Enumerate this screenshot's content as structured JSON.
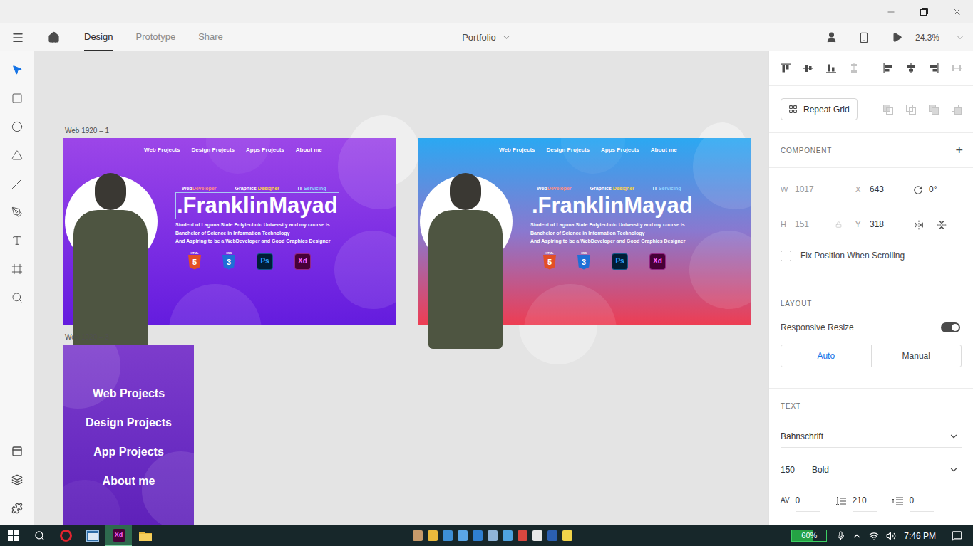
{
  "appbar": {
    "tabs": [
      {
        "label": "Design",
        "selected": true
      },
      {
        "label": "Prototype",
        "selected": false
      },
      {
        "label": "Share",
        "selected": false
      }
    ],
    "document": "Portfolio",
    "zoom": "24.3%"
  },
  "tools": [
    {
      "kind": "select",
      "selected": true
    },
    {
      "kind": "rectangle",
      "selected": false
    },
    {
      "kind": "ellipse",
      "selected": false
    },
    {
      "kind": "triangle",
      "selected": false
    },
    {
      "kind": "line",
      "selected": false
    },
    {
      "kind": "pen",
      "selected": false
    },
    {
      "kind": "text",
      "selected": false
    },
    {
      "kind": "artboard",
      "selected": false
    },
    {
      "kind": "zoom",
      "selected": false
    }
  ],
  "panels": [
    {
      "kind": "assets",
      "selected": false
    },
    {
      "kind": "layers",
      "selected": false
    },
    {
      "kind": "plugins",
      "selected": false
    }
  ],
  "canvas": {
    "artboards": [
      {
        "kind": "hero",
        "label": "Web 1920 – 1",
        "color": "#9c46e8",
        "color_mid": "#7f30e4",
        "color_to": "#641cde",
        "nav": [
          "Web Projects",
          "Design Projects",
          "Apps Projects",
          "About me"
        ],
        "tags": [
          [
            {
              "text": "Web",
              "color": "#ffffff"
            },
            {
              "text": "Developer",
              "color": "#ff8f7e"
            }
          ],
          [
            {
              "text": "Graphics ",
              "color": "#ffffff"
            },
            {
              "text": "Designer",
              "color": "#ffd54a"
            }
          ],
          [
            {
              "text": "IT ",
              "color": "#ffffff"
            },
            {
              "text": "Servicing",
              "color": "#8fd3ff"
            }
          ]
        ],
        "name": ".FranklinMayad",
        "name_selected": true,
        "bio": [
          "Student of Laguna State Polytechnic University and my course is",
          "Banchelor of Science in Information Technology",
          "And Aspiring to be a WebDeveloper and Good Graphics Designer"
        ],
        "skills": [
          {
            "kind": "html",
            "caption": "HTML",
            "mark": "5"
          },
          {
            "kind": "css",
            "caption": "CSS",
            "mark": "3"
          },
          {
            "kind": "ps",
            "mark": "Ps"
          },
          {
            "kind": "xd",
            "mark": "Xd"
          }
        ]
      },
      {
        "kind": "hero",
        "color": "#2ba8f2",
        "color_mid": "#8a78cf",
        "color_to": "#ee3d52",
        "nav": [
          "Web Projects",
          "Design Projects",
          "Apps Projects",
          "About me"
        ],
        "tags": [
          [
            {
              "text": "Web",
              "color": "#ffffff"
            },
            {
              "text": "Developer",
              "color": "#ff8f7e"
            }
          ],
          [
            {
              "text": "Graphics ",
              "color": "#ffffff"
            },
            {
              "text": "Designer",
              "color": "#ffd54a"
            }
          ],
          [
            {
              "text": "IT ",
              "color": "#ffffff"
            },
            {
              "text": "Servicing",
              "color": "#8fd3ff"
            }
          ]
        ],
        "name": ".FranklinMayad",
        "name_selected": false,
        "bio": [
          "Student of Laguna State Polytechnic University and my course is",
          "Banchelor of Science in Information Technology",
          "And Aspiring to be a WebDeveloper and Good Graphics Designer"
        ],
        "skills": [
          {
            "kind": "html",
            "caption": "HTML",
            "mark": "5"
          },
          {
            "kind": "css",
            "caption": "CSS",
            "mark": "3"
          },
          {
            "kind": "ps",
            "mark": "Ps"
          },
          {
            "kind": "xd",
            "mark": "Xd"
          }
        ]
      },
      {
        "kind": "menu",
        "label": "Web 1920 – 3",
        "color": "#7d3ccc",
        "color_mid": "#6a2cc2",
        "color_to": "#5a1cb6",
        "items": [
          "Web Projects",
          "Design Projects",
          "App Projects",
          "About me"
        ]
      }
    ]
  },
  "inspector": {
    "repeat_grid": "Repeat Grid",
    "component": {
      "title": "COMPONENT",
      "add": "+"
    },
    "transform": {
      "fields": [
        {
          "label": "W",
          "value": "1017",
          "disabled": true
        },
        {
          "label": "X",
          "value": "643",
          "disabled": false
        },
        {
          "label": "H",
          "value": "151",
          "disabled": true
        },
        {
          "label": "Y",
          "value": "318",
          "disabled": false
        }
      ],
      "rotation": "0°"
    },
    "fix_position": {
      "label": "Fix Position When Scrolling",
      "checked": false
    },
    "layout": {
      "title": "LAYOUT",
      "responsive": {
        "label": "Responsive Resize",
        "on": true
      },
      "modes": [
        {
          "label": "Auto",
          "selected": true
        },
        {
          "label": "Manual",
          "selected": false
        }
      ]
    },
    "text": {
      "title": "TEXT",
      "font": "Bahnschrift",
      "size": "150",
      "weight": "Bold",
      "spacing": [
        {
          "kind": "character",
          "icon": "AV",
          "value": "0"
        },
        {
          "kind": "line",
          "value": "210"
        },
        {
          "kind": "paragraph",
          "value": "0"
        }
      ]
    }
  },
  "taskbar": {
    "apps": [
      {
        "kind": "opera",
        "active": false
      },
      {
        "kind": "window",
        "active": false
      },
      {
        "kind": "xd",
        "label": "Xd",
        "active": true
      },
      {
        "kind": "folder",
        "active": false
      }
    ],
    "pinned": [
      {
        "color": "#c79a6a"
      },
      {
        "color": "#e9b93c"
      },
      {
        "color": "#3d8fd6"
      },
      {
        "color": "#5aa6e6"
      },
      {
        "color": "#2f7fd0"
      },
      {
        "color": "#8fb4d8"
      },
      {
        "color": "#4fa3e0"
      },
      {
        "color": "#d9473f"
      },
      {
        "color": "#e8e8e8"
      },
      {
        "color": "#2b5fb0"
      },
      {
        "color": "#f2d44a"
      }
    ],
    "battery": {
      "reading": "60%",
      "level": 0.6
    },
    "time": "7:46 PM"
  }
}
